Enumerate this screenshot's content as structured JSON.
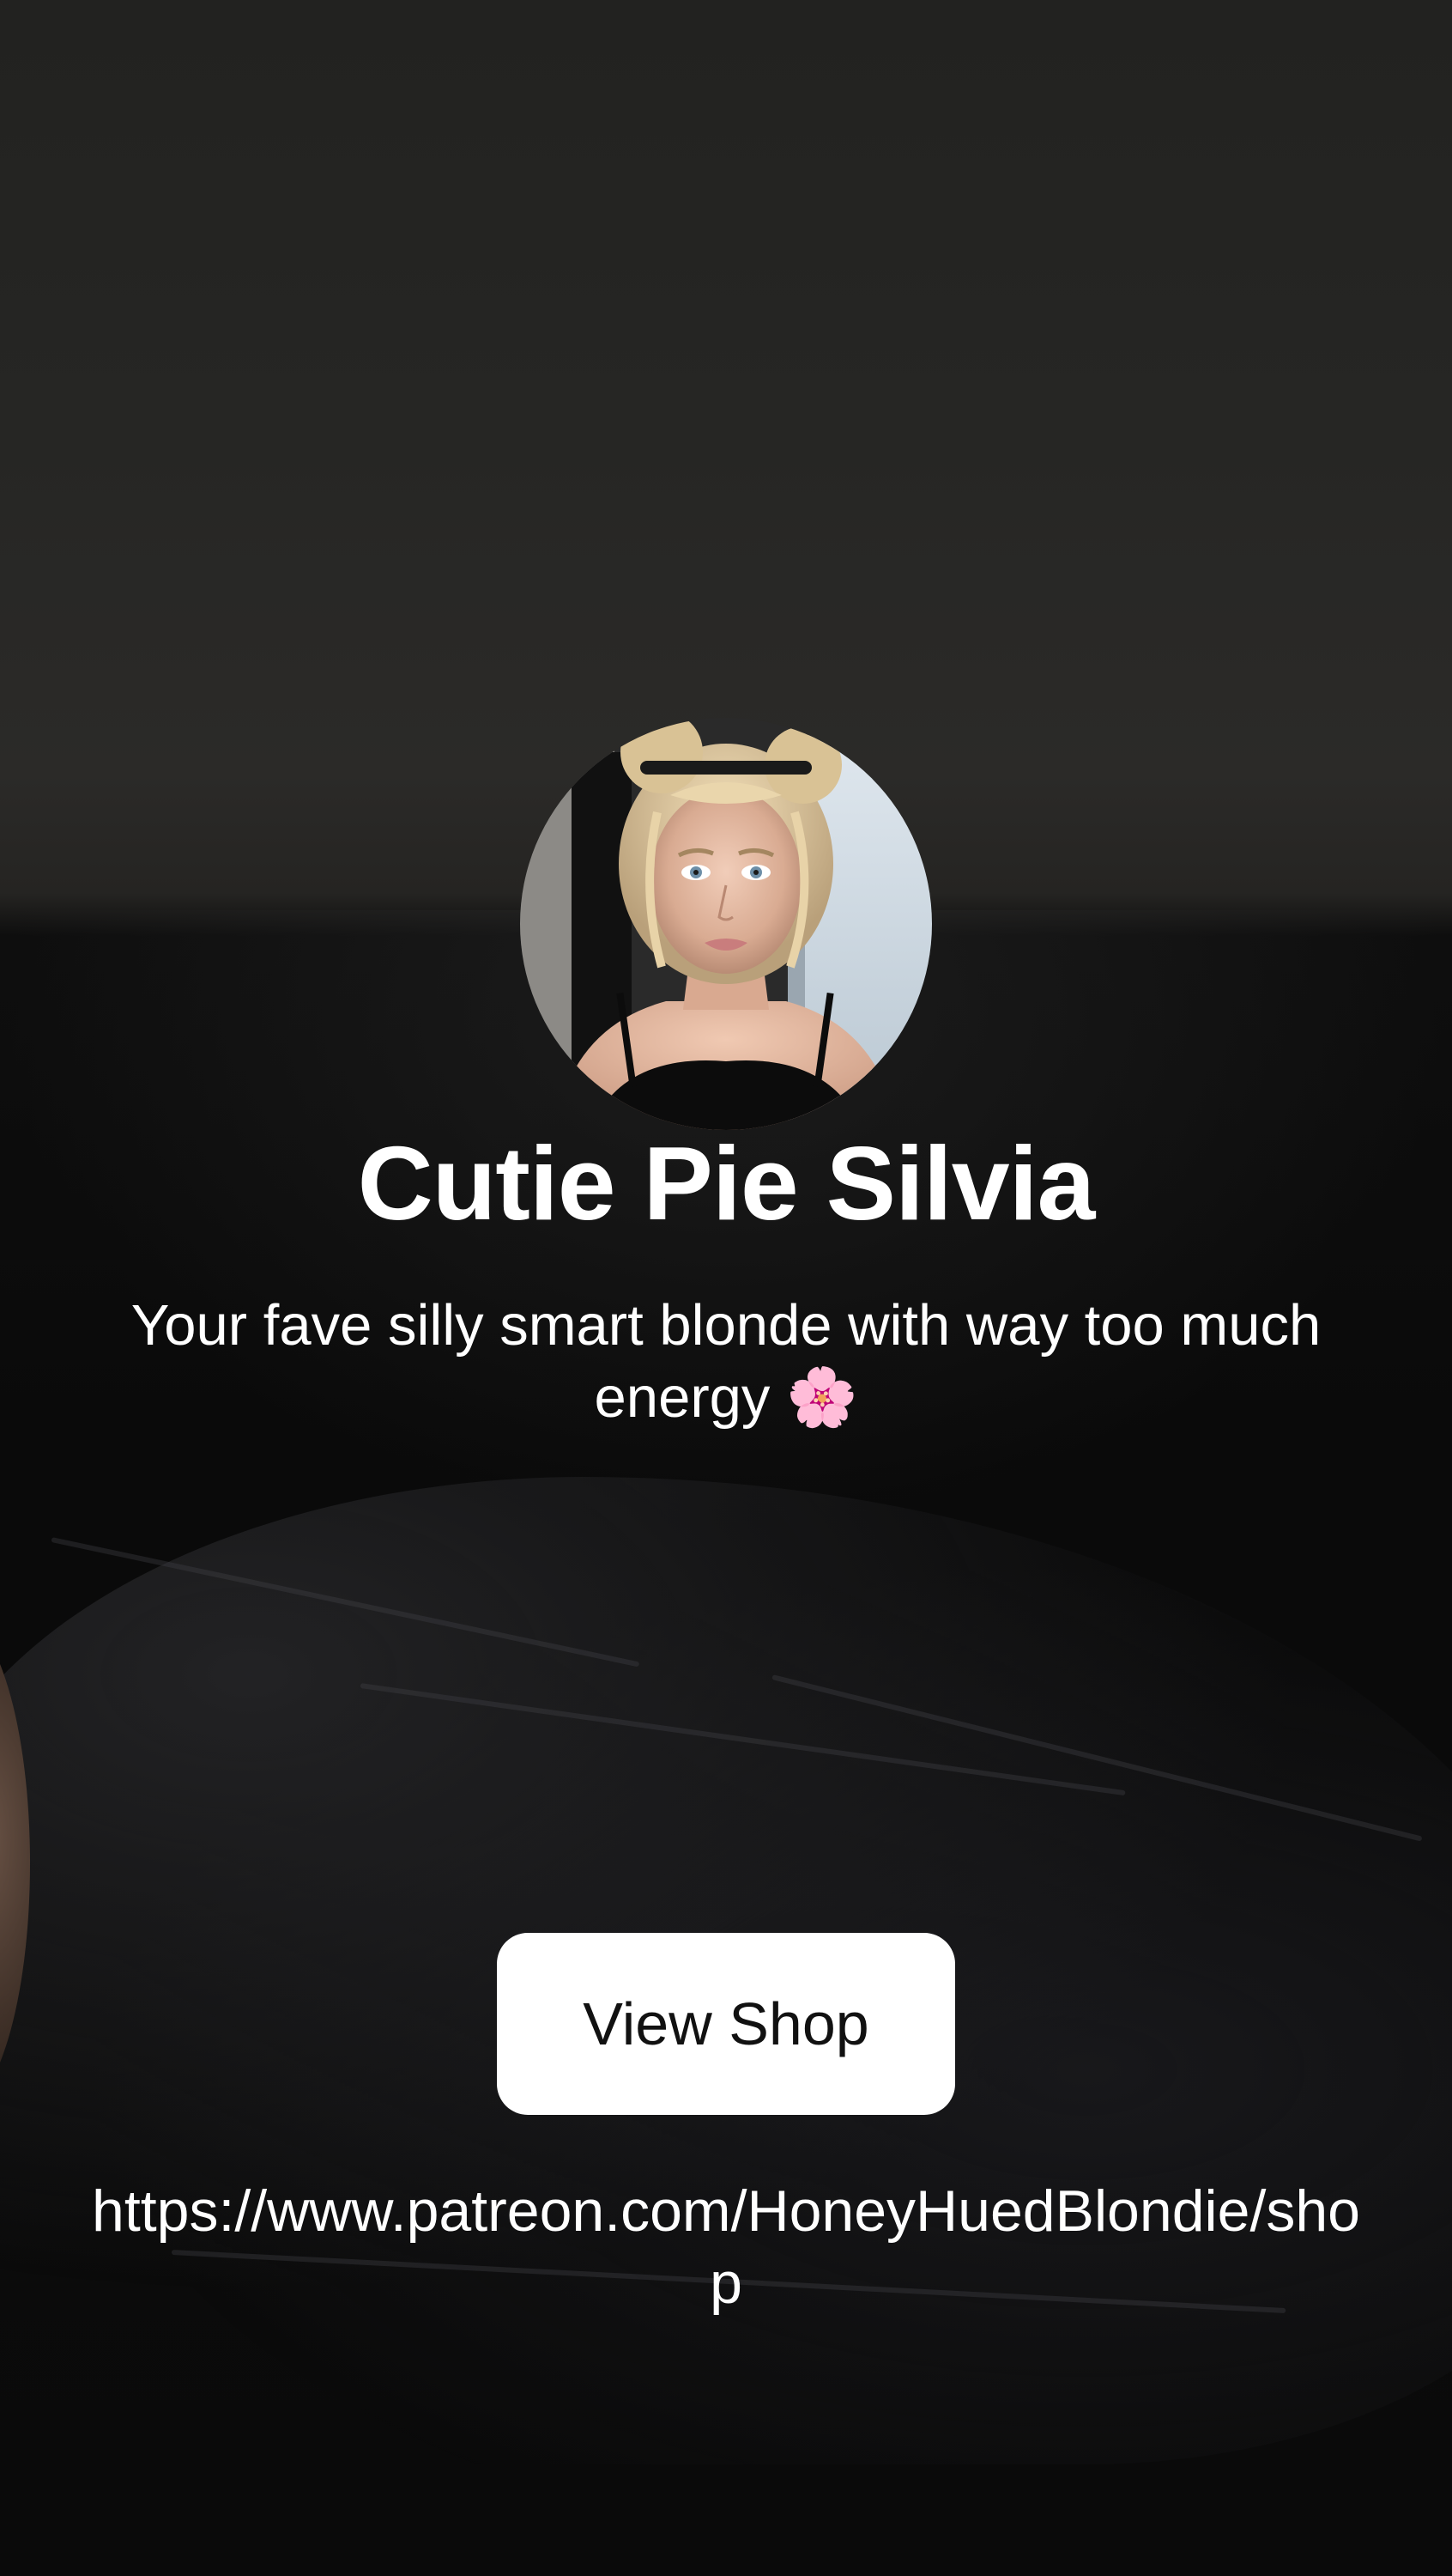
{
  "profile": {
    "name": "Cutie Pie Silvia",
    "bio": "Your fave silly smart blonde with way too much energy 🌸",
    "avatar_icon": "profile-photo"
  },
  "links": [
    {
      "button_label": "View Shop",
      "url": "https://www.patreon.com/HoneyHuedBlondie/shop"
    }
  ],
  "colors": {
    "text": "#ffffff",
    "button_background": "#ffffff",
    "button_text": "#111111",
    "background": "#0b0b0b"
  }
}
